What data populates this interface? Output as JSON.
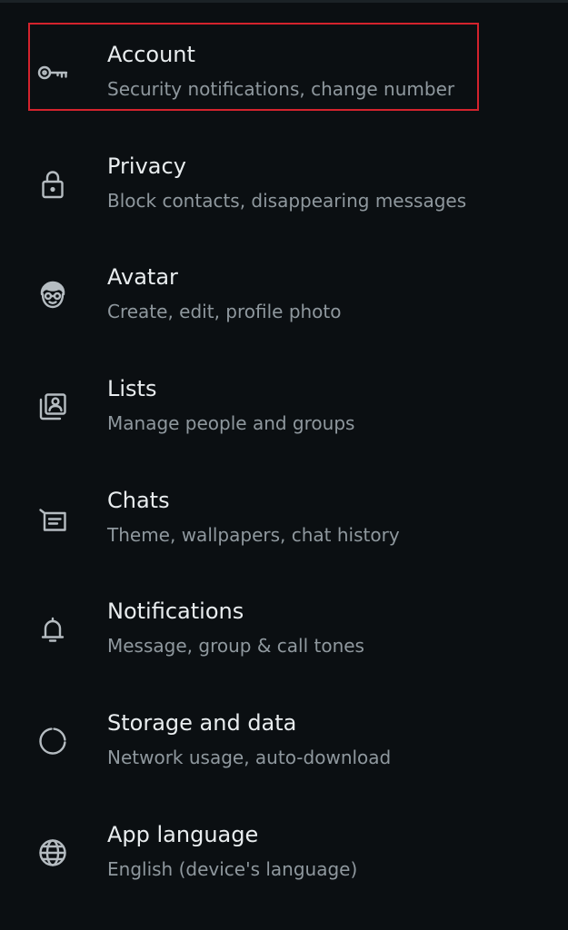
{
  "settings": {
    "items": [
      {
        "key": "account",
        "title": "Account",
        "subtitle": "Security notifications, change number",
        "icon": "key-icon",
        "highlighted": true
      },
      {
        "key": "privacy",
        "title": "Privacy",
        "subtitle": "Block contacts, disappearing messages",
        "icon": "lock-icon"
      },
      {
        "key": "avatar",
        "title": "Avatar",
        "subtitle": "Create, edit, profile photo",
        "icon": "avatar-face-icon"
      },
      {
        "key": "lists",
        "title": "Lists",
        "subtitle": "Manage people and groups",
        "icon": "contact-list-icon"
      },
      {
        "key": "chats",
        "title": "Chats",
        "subtitle": "Theme, wallpapers, chat history",
        "icon": "chat-message-icon"
      },
      {
        "key": "notifications",
        "title": "Notifications",
        "subtitle": "Message, group & call tones",
        "icon": "bell-icon"
      },
      {
        "key": "storage",
        "title": "Storage and data",
        "subtitle": "Network usage, auto-download",
        "icon": "storage-circle-icon"
      },
      {
        "key": "language",
        "title": "App language",
        "subtitle": "English (device's language)",
        "icon": "globe-icon"
      }
    ]
  },
  "colors": {
    "background": "#0b0f12",
    "title": "#e9edef",
    "subtitle": "#8f989e",
    "icon": "#b5bcc1",
    "highlight": "#d4232d"
  }
}
